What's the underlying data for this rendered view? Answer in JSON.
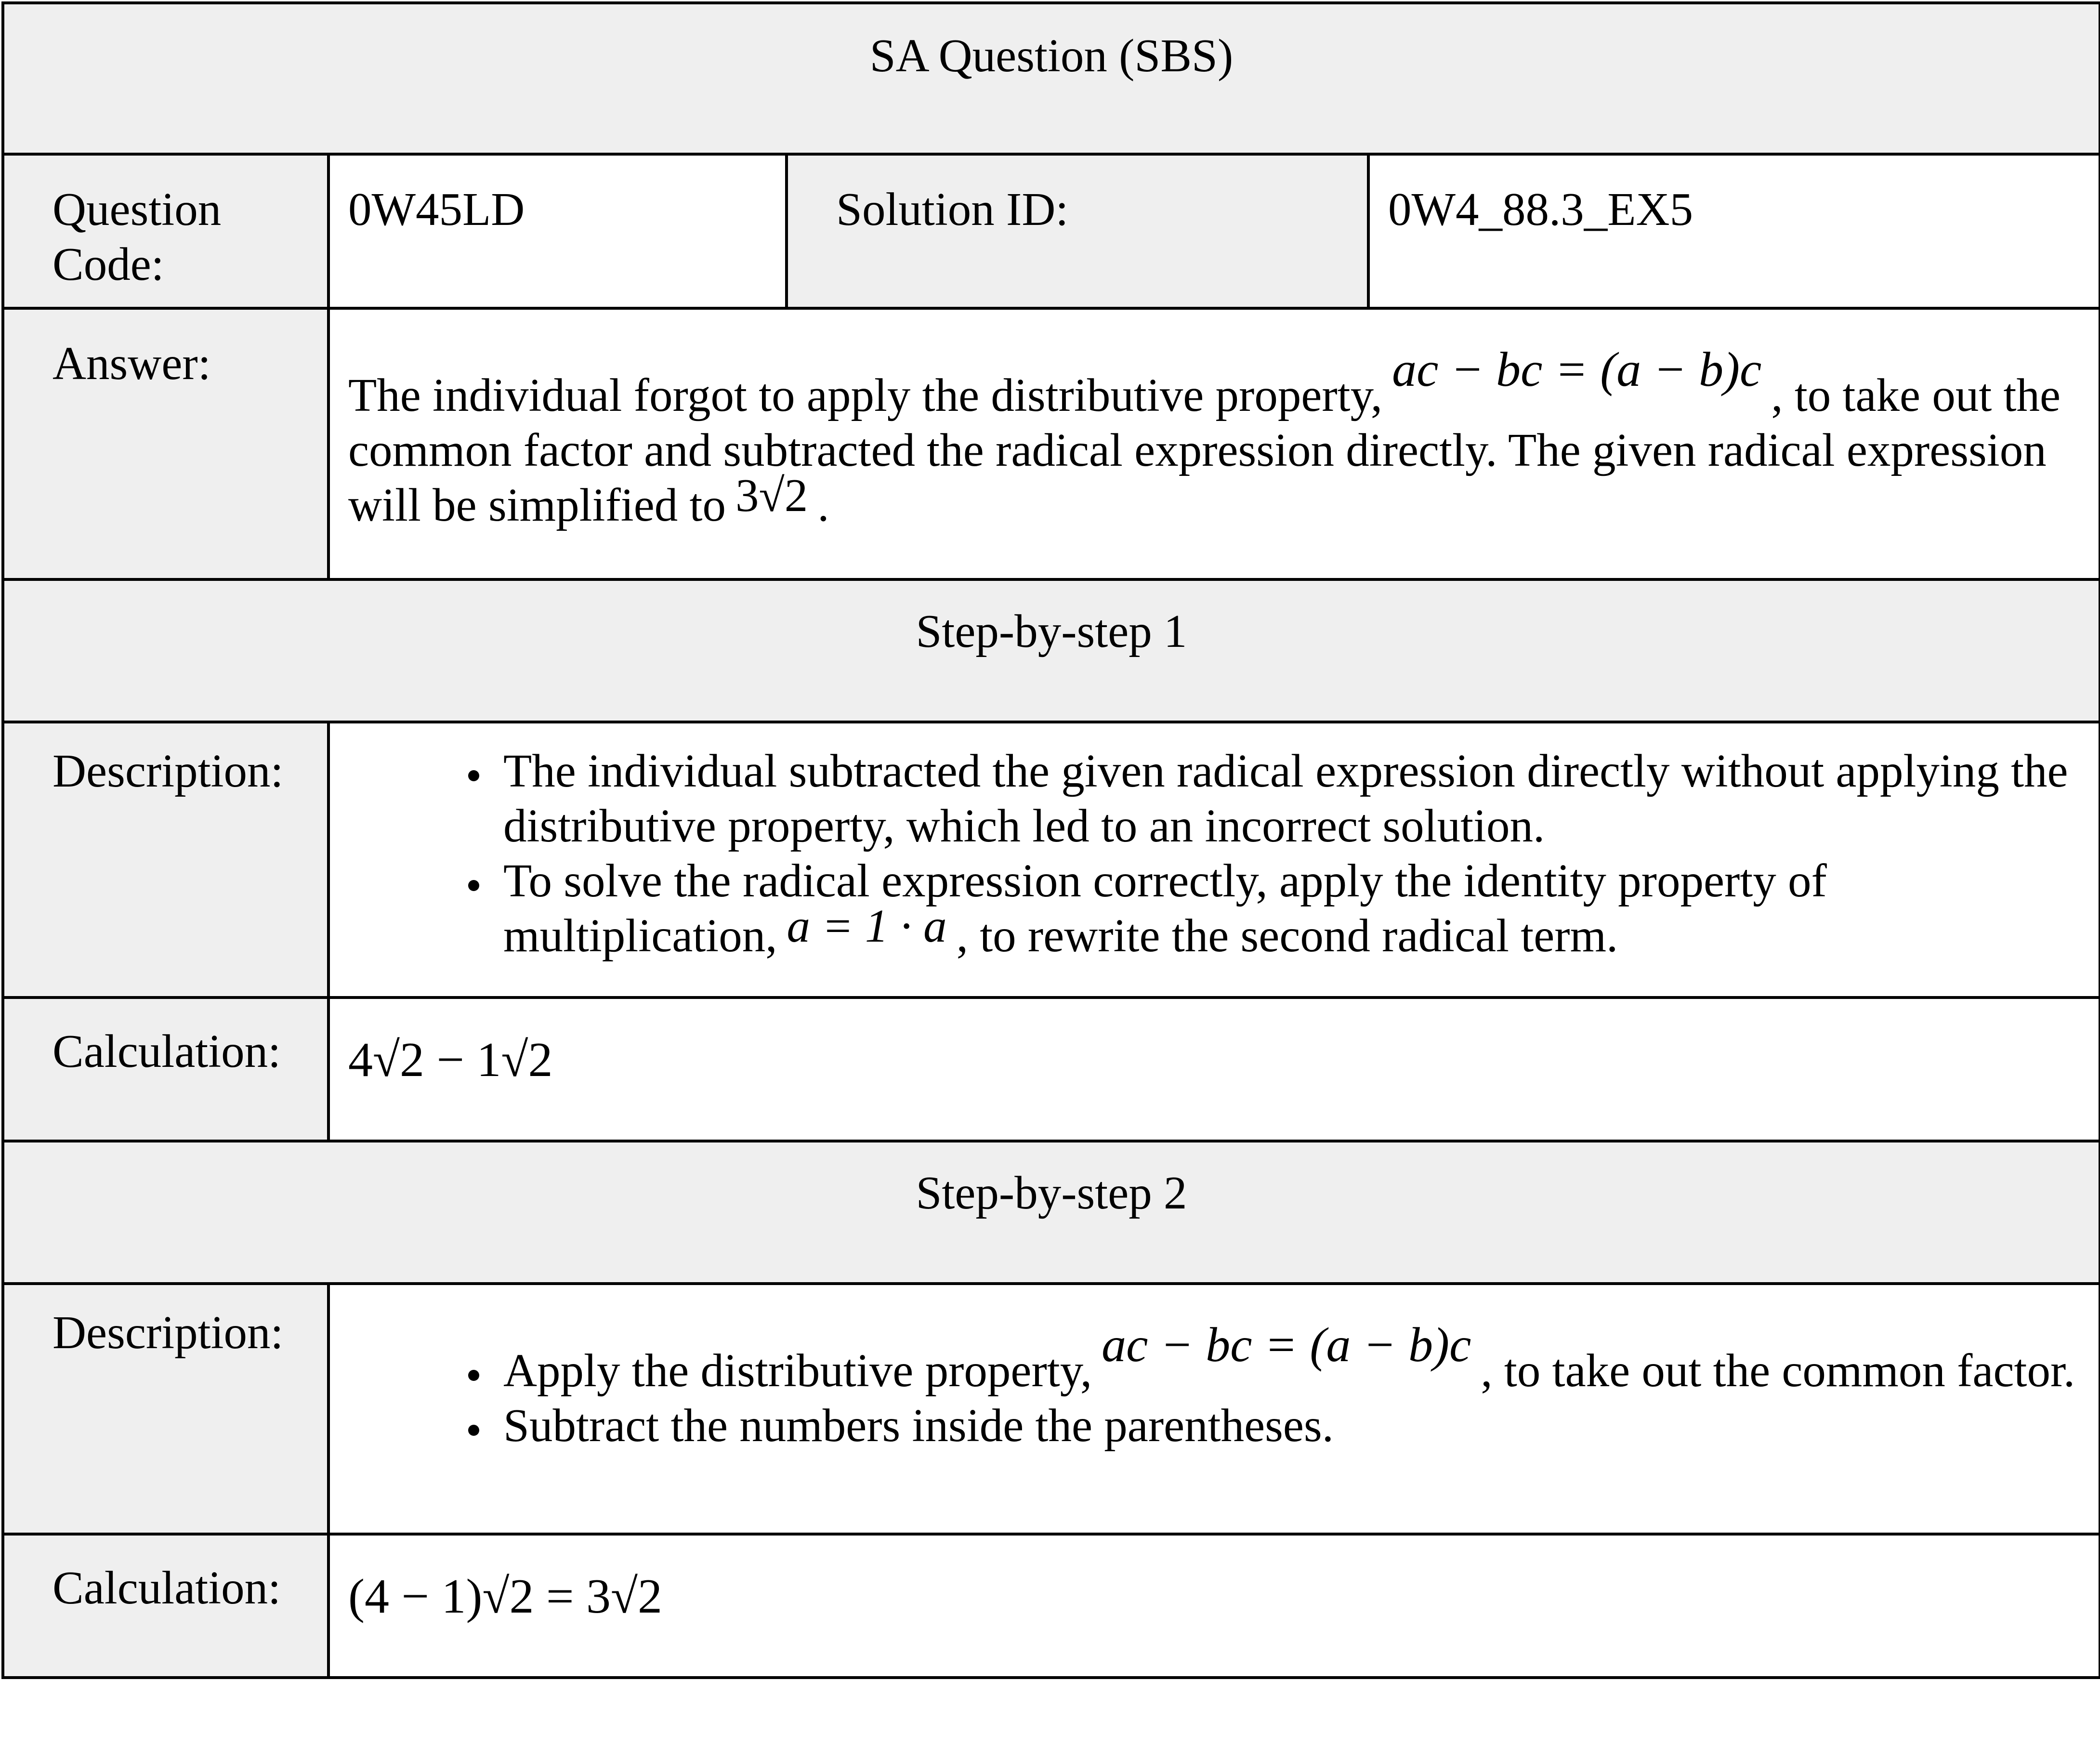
{
  "title": "SA Question (SBS)",
  "question_code_label": "Question Code:",
  "question_code": "0W45LD",
  "solution_id_label": "Solution ID:",
  "solution_id": "0W4_88.3_EX5",
  "answer_label": "Answer:",
  "answer": {
    "part1": "The individual forgot to apply the distributive property,",
    "formula": "ac − bc = (a − b)c",
    "part2": ", to take out the common factor and subtracted the radical expression directly. The given radical expression will be simplified to",
    "result": "3√2",
    "end": "."
  },
  "steps": [
    {
      "heading": "Step-by-step 1",
      "description_label": "Description:",
      "bullets": [
        {
          "text": "The individual subtracted the given radical expression directly without applying the distributive property, which led to an incorrect solution."
        },
        {
          "pre": "To solve the radical expression correctly, apply the identity property of multiplication,",
          "formula": "a = 1 · a",
          "post": ", to rewrite the second radical term."
        }
      ],
      "calculation_label": "Calculation:",
      "calculation": "4√2 − 1√2"
    },
    {
      "heading": "Step-by-step 2",
      "description_label": "Description:",
      "bullets": [
        {
          "pre": "Apply the distributive property,",
          "formula": "ac − bc = (a − b)c",
          "post": ", to take out the common factor."
        },
        {
          "text": "Subtract the numbers inside the parentheses."
        }
      ],
      "calculation_label": "Calculation:",
      "calculation": "(4 − 1)√2 = 3√2"
    }
  ]
}
